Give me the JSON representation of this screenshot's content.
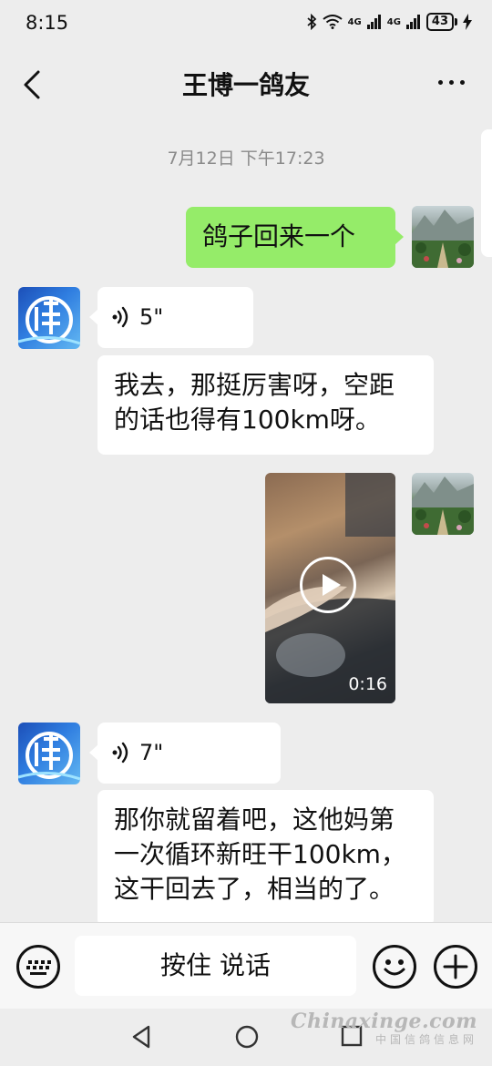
{
  "status_bar": {
    "time": "8:15",
    "network_1": "4G",
    "network_2": "4G",
    "battery_level": "43"
  },
  "header": {
    "title": "王博一鸽友"
  },
  "chat": {
    "timestamp": "7月12日 下午17:23",
    "messages": [
      {
        "from": "self",
        "type": "text",
        "text": "鸽子回来一个"
      },
      {
        "from": "contact",
        "type": "voice",
        "duration": "5\""
      },
      {
        "from": "contact",
        "type": "text",
        "text": "我去，那挺厉害呀，空距的话也得有100km呀。"
      },
      {
        "from": "self",
        "type": "video",
        "duration": "0:16"
      },
      {
        "from": "contact",
        "type": "voice",
        "duration": "7\""
      },
      {
        "from": "contact",
        "type": "text",
        "text": "那你就留着吧，这他妈第一次循环新旺干100km，这干回去了，相当的了。"
      }
    ]
  },
  "input_bar": {
    "hold_to_talk": "按住 说话"
  },
  "watermark": {
    "main": "Chinaxinge.com",
    "sub": "中国信鸽信息网"
  },
  "colors": {
    "self_bubble": "#95ec69",
    "contact_bubble": "#ffffff",
    "background": "#ededed",
    "avatar_contact": "#2f7de0"
  }
}
